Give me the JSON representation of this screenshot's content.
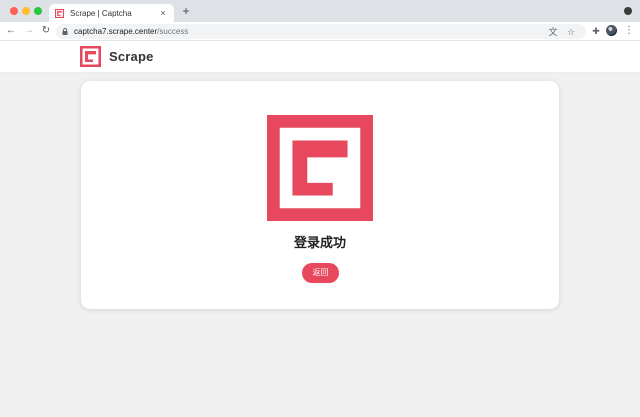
{
  "browser": {
    "tab": {
      "title": "Scrape | Captcha",
      "close_glyph": "×",
      "favicon": "scrape-logo-icon"
    },
    "new_tab_glyph": "+",
    "nav": {
      "back_glyph": "←",
      "forward_glyph": "→",
      "reload_glyph": "↻"
    },
    "url": {
      "host": "captcha7.scrape.center",
      "path": "/success"
    },
    "icons": {
      "translate": "translate-icon",
      "star": "star-icon",
      "extensions": "puzzle-icon",
      "menu": "kebab-icon"
    },
    "translate_glyph": "文",
    "star_glyph": "☆",
    "extensions_glyph": "✚",
    "kebab_glyph": "⋮"
  },
  "site": {
    "name": "Scrape",
    "brand_color": "#e8485d"
  },
  "content": {
    "title": "登录成功",
    "return_label": "返回"
  }
}
